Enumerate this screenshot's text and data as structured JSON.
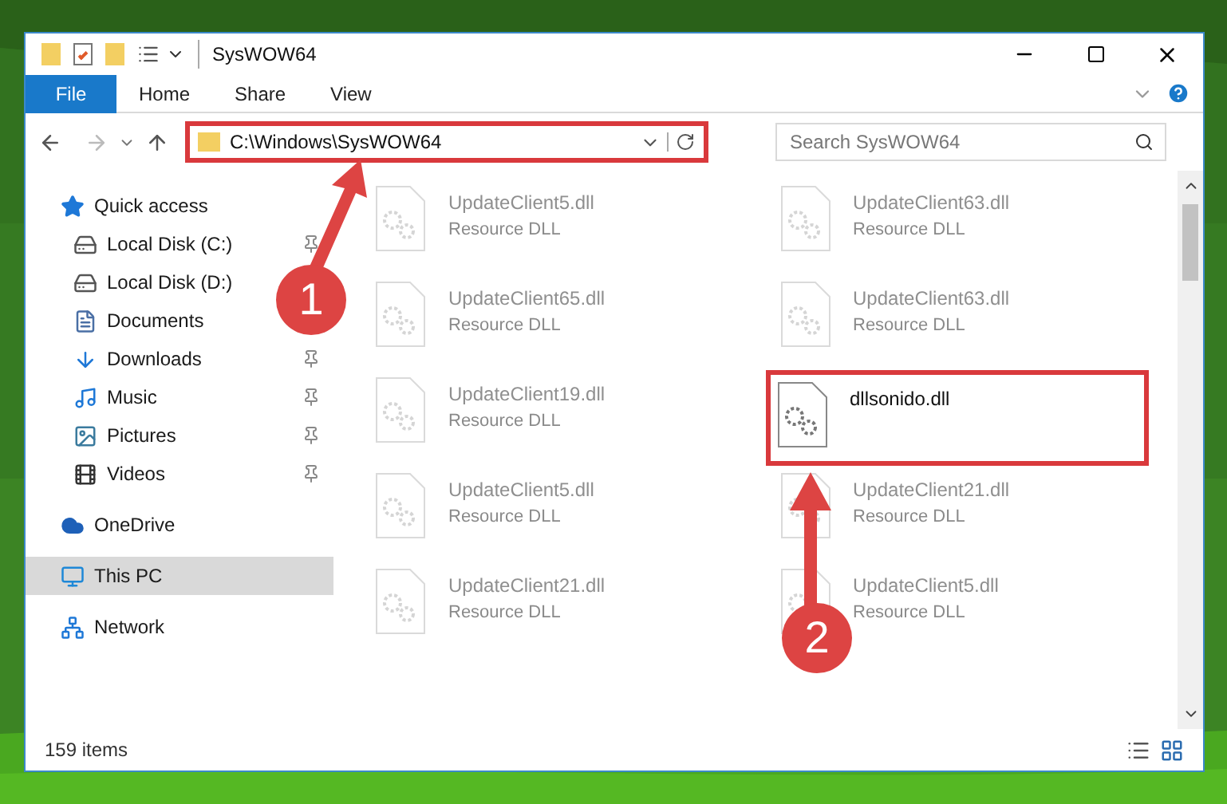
{
  "window": {
    "title": "SysWOW64"
  },
  "ribbon_tabs": [
    {
      "label": "File",
      "selected": true
    },
    {
      "label": "Home",
      "selected": false
    },
    {
      "label": "Share",
      "selected": false
    },
    {
      "label": "View",
      "selected": false
    }
  ],
  "address_bar": {
    "path": "C:\\Windows\\SysWOW64",
    "highlighted": true
  },
  "search": {
    "placeholder": "Search SysWOW64"
  },
  "nav": [
    {
      "label": "Quick access",
      "kind": "star",
      "selected": false,
      "children": [
        {
          "label": "Local Disk (C:)",
          "kind": "drive",
          "pinned": true,
          "selected": false
        },
        {
          "label": "Local Disk (D:)",
          "kind": "drive",
          "pinned": false,
          "selected": false
        },
        {
          "label": "Documents",
          "kind": "documents",
          "pinned": false,
          "selected": false
        },
        {
          "label": "Downloads",
          "kind": "downloads",
          "pinned": true,
          "selected": false
        },
        {
          "label": "Music",
          "kind": "music",
          "pinned": true,
          "selected": false
        },
        {
          "label": "Pictures",
          "kind": "pictures",
          "pinned": true,
          "selected": false
        },
        {
          "label": "Videos",
          "kind": "videos",
          "pinned": true,
          "selected": false
        }
      ]
    },
    {
      "label": "OneDrive",
      "kind": "cloud",
      "selected": false
    },
    {
      "label": "This PC",
      "kind": "pc",
      "selected": true
    },
    {
      "label": "Network",
      "kind": "network",
      "selected": false
    }
  ],
  "files": [
    {
      "name": "UpdateClient5.dll",
      "type": "Resource DLL",
      "highlighted": false,
      "dimmed": true
    },
    {
      "name": "UpdateClient63.dll",
      "type": "Resource DLL",
      "highlighted": false,
      "dimmed": true
    },
    {
      "name": "UpdateClient65.dll",
      "type": "Resource DLL",
      "highlighted": false,
      "dimmed": true
    },
    {
      "name": "UpdateClient63.dll",
      "type": "Resource DLL",
      "highlighted": false,
      "dimmed": true
    },
    {
      "name": "UpdateClient19.dll",
      "type": "Resource DLL",
      "highlighted": false,
      "dimmed": true
    },
    {
      "name": "dllsonido.dll",
      "highlighted": true,
      "dimmed": false
    },
    {
      "name": "UpdateClient5.dll",
      "type": "Resource DLL",
      "highlighted": false,
      "dimmed": true
    },
    {
      "name": "UpdateClient21.dll",
      "type": "Resource DLL",
      "highlighted": false,
      "dimmed": true
    },
    {
      "name": "UpdateClient21.dll",
      "type": "Resource DLL",
      "highlighted": false,
      "dimmed": true
    },
    {
      "name": "UpdateClient5.dll",
      "type": "Resource DLL",
      "highlighted": false,
      "dimmed": true
    }
  ],
  "status_bar": {
    "item_count": "159 items"
  },
  "callouts": [
    {
      "label": "1"
    },
    {
      "label": "2"
    }
  ]
}
